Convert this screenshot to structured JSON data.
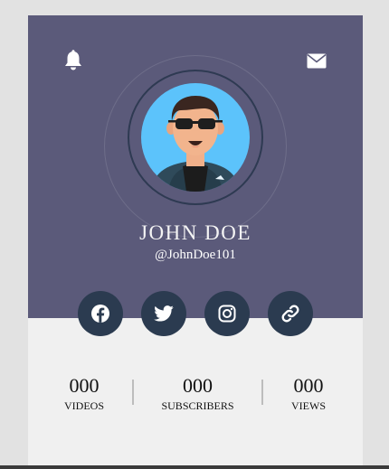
{
  "profile": {
    "name": "JOHN DOE",
    "handle": "@JohnDoe101"
  },
  "header_icons": {
    "left": "bell-icon",
    "right": "mail-icon"
  },
  "social_links": [
    {
      "icon": "facebook-icon"
    },
    {
      "icon": "twitter-icon"
    },
    {
      "icon": "instagram-icon"
    },
    {
      "icon": "link-icon"
    }
  ],
  "stats": [
    {
      "value": "000",
      "label": "VIDEOS"
    },
    {
      "value": "000",
      "label": "SUBSCRIBERS"
    },
    {
      "value": "000",
      "label": "VIEWS"
    }
  ],
  "colors": {
    "page_background": "#e2e2e2",
    "card_header": "#5b5a7a",
    "card_body": "#f0f0f0",
    "social_button": "#2b3b50",
    "avatar_background": "#5cc3fb"
  }
}
